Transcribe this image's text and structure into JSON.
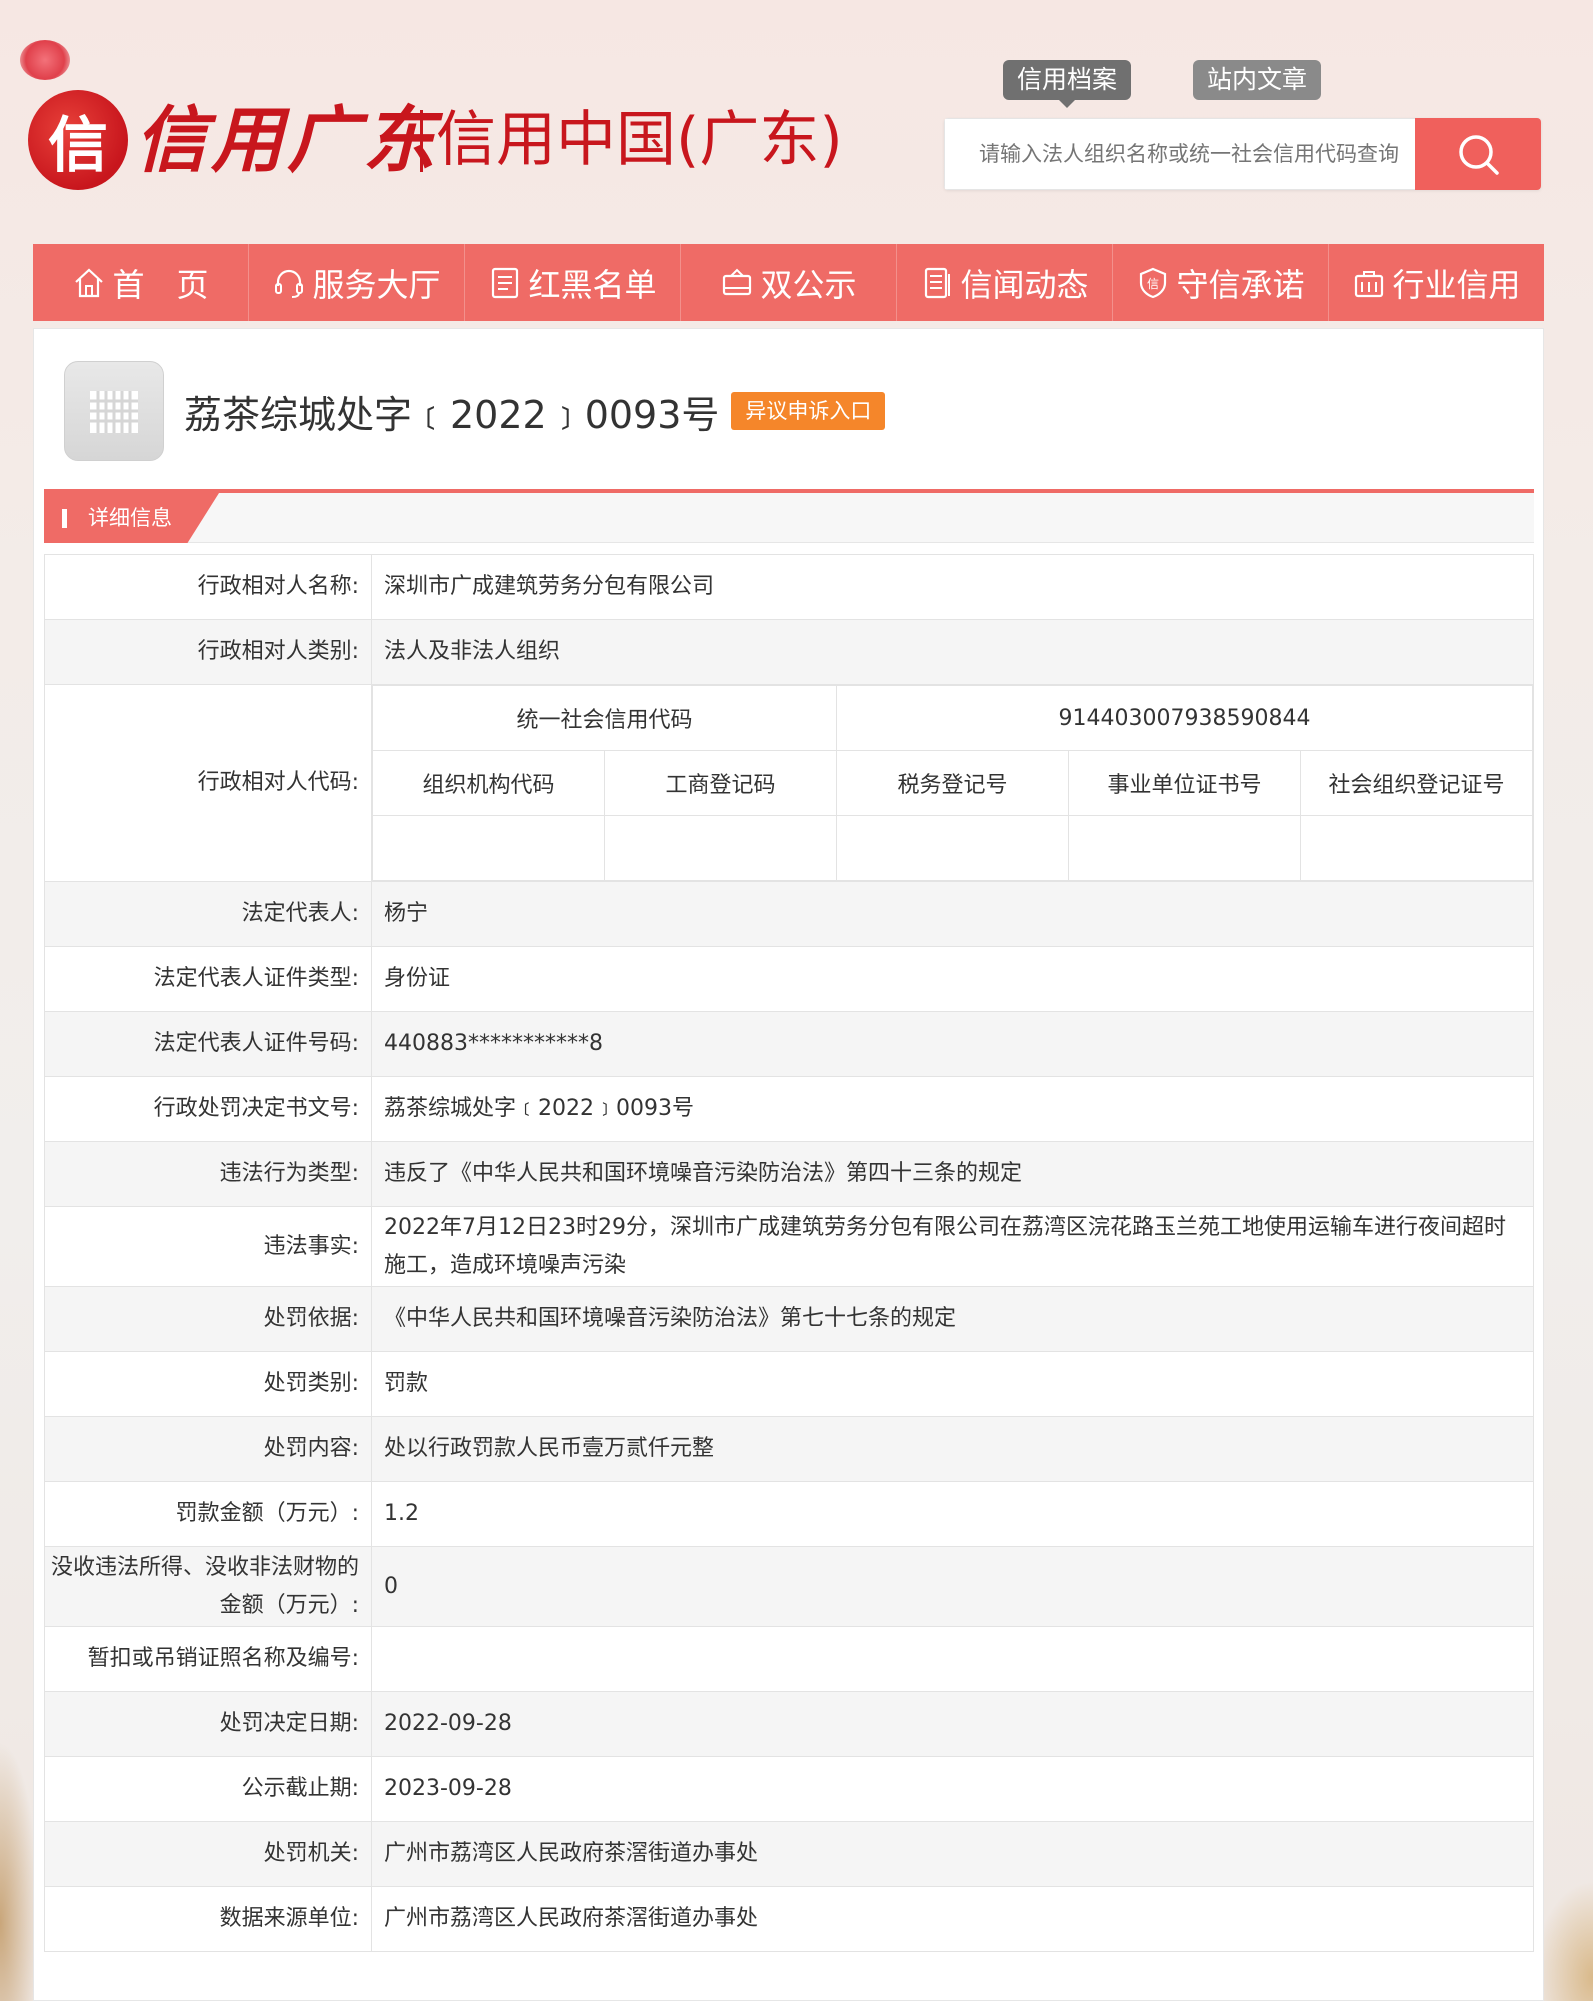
{
  "header": {
    "brand_calligraphy": "信用广东",
    "brand_subtitle": "信用中国(广东)",
    "logo_char": "信",
    "tabs": [
      "信用档案",
      "站内文章"
    ],
    "search_placeholder": "请输入法人组织名称或统一社会信用代码查询"
  },
  "nav": {
    "items": [
      {
        "label": "首　页",
        "icon": "home-icon"
      },
      {
        "label": "服务大厅",
        "icon": "headset-icon"
      },
      {
        "label": "红黑名单",
        "icon": "list-icon"
      },
      {
        "label": "双公示",
        "icon": "monitor-icon"
      },
      {
        "label": "信闻动态",
        "icon": "news-icon"
      },
      {
        "label": "守信承诺",
        "icon": "shield-icon"
      },
      {
        "label": "行业信用",
        "icon": "briefcase-icon"
      }
    ]
  },
  "doc": {
    "title": "荔茶综城处字﹝2022﹞0093号",
    "objection_label": "异议申诉入口"
  },
  "section": {
    "label": "详细信息"
  },
  "details": {
    "name_label": "行政相对人名称:",
    "name_value": "深圳市广成建筑劳务分包有限公司",
    "category_label": "行政相对人类别:",
    "category_value": "法人及非法人组织",
    "code_label": "行政相对人代码:",
    "uscc_label": "统一社会信用代码",
    "uscc_value": "914403007938590844",
    "code_headers": [
      "组织机构代码",
      "工商登记码",
      "税务登记号",
      "事业单位证书号",
      "社会组织登记证号"
    ],
    "legal_rep_label": "法定代表人:",
    "legal_rep_value": "杨宁",
    "id_type_label": "法定代表人证件类型:",
    "id_type_value": "身份证",
    "id_no_label": "法定代表人证件号码:",
    "id_no_value": "440883***********8",
    "decision_no_label": "行政处罚决定书文号:",
    "decision_no_value": "荔茶综城处字﹝2022﹞0093号",
    "violation_type_label": "违法行为类型:",
    "violation_type_value": "违反了《中华人民共和国环境噪音污染防治法》第四十三条的规定",
    "facts_label": "违法事实:",
    "facts_value": "2022年7月12日23时29分，深圳市广成建筑劳务分包有限公司在荔湾区浣花路玉兰苑工地使用运输车进行夜间超时施工，造成环境噪声污染",
    "basis_label": "处罚依据:",
    "basis_value": "《中华人民共和国环境噪音污染防治法》第七十七条的规定",
    "penalty_type_label": "处罚类别:",
    "penalty_type_value": "罚款",
    "penalty_content_label": "处罚内容:",
    "penalty_content_value": "处以行政罚款人民币壹万贰仟元整",
    "fine_label": "罚款金额（万元）:",
    "fine_value": "1.2",
    "confiscation_label": "没收违法所得、没收非法财物的金额（万元）:",
    "confiscation_value": "0",
    "license_label": "暂扣或吊销证照名称及编号:",
    "license_value": "",
    "decision_date_label": "处罚决定日期:",
    "decision_date_value": "2022-09-28",
    "publicity_end_label": "公示截止期:",
    "publicity_end_value": "2023-09-28",
    "authority_label": "处罚机关:",
    "authority_value": "广州市荔湾区人民政府茶滘街道办事处",
    "source_label": "数据来源单位:",
    "source_value": "广州市荔湾区人民政府茶滘街道办事处"
  },
  "colors": {
    "accent": "#ef6b66",
    "brand_red": "#c8161d",
    "orange_button": "#f5862a"
  }
}
